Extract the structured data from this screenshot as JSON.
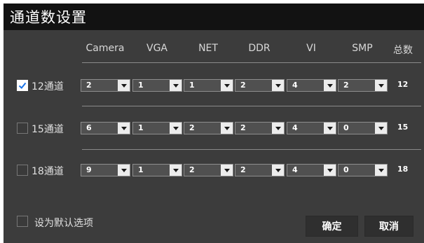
{
  "window": {
    "title": "通道数设置"
  },
  "columns": [
    "Camera",
    "VGA",
    "NET",
    "DDR",
    "VI",
    "SMP",
    "总数"
  ],
  "rows": [
    {
      "label": "12通道",
      "checked": true,
      "values": [
        "2",
        "1",
        "1",
        "2",
        "4",
        "2"
      ],
      "total": "12"
    },
    {
      "label": "15通道",
      "checked": false,
      "values": [
        "6",
        "1",
        "2",
        "2",
        "4",
        "0"
      ],
      "total": "15"
    },
    {
      "label": "18通道",
      "checked": false,
      "values": [
        "9",
        "1",
        "2",
        "2",
        "4",
        "0"
      ],
      "total": "18"
    }
  ],
  "footer": {
    "default_label": "设为默认选项",
    "confirm_label": "确定",
    "cancel_label": "取消"
  },
  "colors": {
    "accent": "#1a73e8",
    "dialog_bg": "#3c3c3c",
    "titlebar_bg": "#121212"
  },
  "icons": {
    "checked": "checkmark-icon",
    "dropdown": "chevron-down-icon"
  }
}
